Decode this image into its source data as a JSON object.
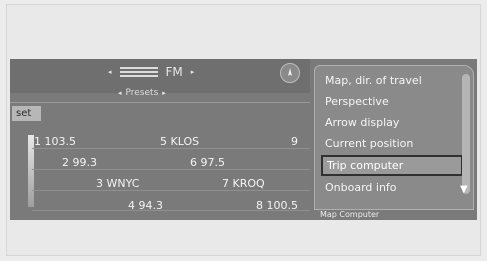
{
  "top_bar": {
    "left_arrow": "◂",
    "right_arrow": "▸",
    "source_icon": "radio-source-icon",
    "band": "FM",
    "presets_label": "Presets",
    "presets_left_arrow": "◂",
    "presets_right_arrow": "▸",
    "nav_icon": "compass-icon"
  },
  "set_tab": "set",
  "stations": [
    {
      "label": "1 103.5"
    },
    {
      "label": "5 KLOS"
    },
    {
      "label": "9"
    },
    {
      "label": "2 99.3"
    },
    {
      "label": "6 97.5"
    },
    {
      "label": "3 WNYC"
    },
    {
      "label": "7 KROQ"
    },
    {
      "label": "4 94.3"
    },
    {
      "label": "8 100.5"
    }
  ],
  "menu": {
    "items": [
      {
        "label": "Map, dir. of travel"
      },
      {
        "label": "Perspective"
      },
      {
        "label": "Arrow display"
      },
      {
        "label": "Current position"
      },
      {
        "label": "Trip computer"
      },
      {
        "label": "Onboard info"
      }
    ],
    "selected_index": 4,
    "scroll_down_icon": "chevron-down-icon"
  },
  "bottom_strip": "Map Computer"
}
